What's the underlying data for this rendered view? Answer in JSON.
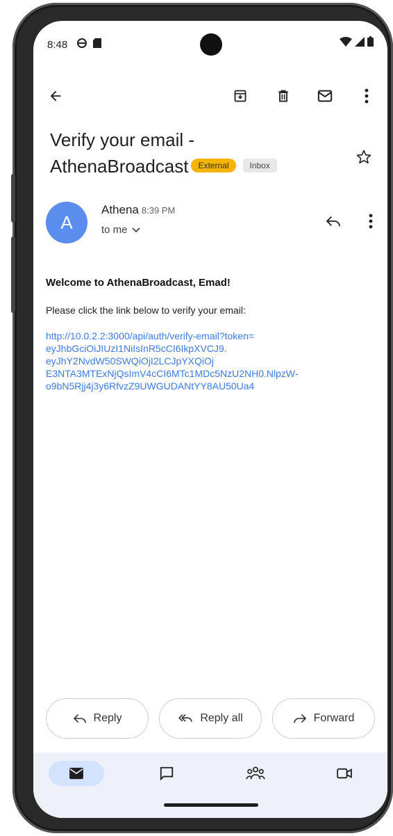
{
  "status_bar": {
    "time": "8:48"
  },
  "email": {
    "subject_line1": "Verify your email -",
    "subject_line2": "AthenaBroadcast",
    "badge_external": "External",
    "badge_inbox": "Inbox",
    "avatar_letter": "A",
    "sender_name": "Athena",
    "sent_time": "8:39 PM",
    "recipient": "to me",
    "body_heading": "Welcome to AthenaBroadcast, Emad!",
    "body_text": "Please click the link below to verify your email:",
    "link_lines": [
      "http://10.0.2.2:3000/api/auth/verify-email?token=",
      "eyJhbGciOiJIUzI1NiIsInR5cCI6IkpXVCJ9.",
      "eyJhY2NvdW50SWQiOjI2LCJpYXQiOj",
      "E3NTA3MTExNjQsImV4cCI6MTc1MDc5NzU2NH0.NlpzW-",
      "o9bN5Rjj4j3y6RfvzZ9UWGUDANtYY8AU50Ua4"
    ]
  },
  "actions": {
    "reply": "Reply",
    "reply_all": "Reply all",
    "forward": "Forward"
  },
  "colors": {
    "accent": "#3c7be8",
    "avatar": "#5b8def",
    "external_badge": "#f4b400",
    "nav_active": "#d3e3fd"
  }
}
